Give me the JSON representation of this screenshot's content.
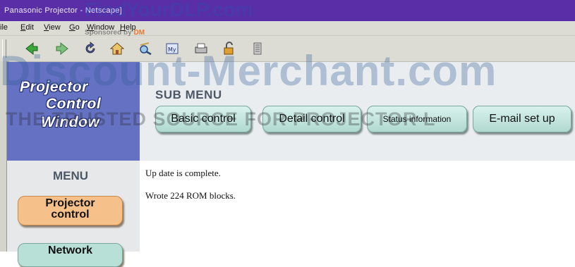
{
  "window": {
    "title": "Panasonic Projector - Netscape]"
  },
  "menu_bar": {
    "items": [
      {
        "label": "ile",
        "underline": ""
      },
      {
        "label": "Edit",
        "underline": "E"
      },
      {
        "label": "View",
        "underline": "V"
      },
      {
        "label": "Go",
        "underline": "G"
      },
      {
        "label": "Window",
        "underline": "W"
      },
      {
        "label": "Help",
        "underline": "H"
      }
    ]
  },
  "toolbar": {
    "icons": [
      "back-icon",
      "forward-icon",
      "reload-icon",
      "home-icon",
      "search-icon",
      "my-netscape-icon",
      "print-icon",
      "security-icon",
      "stop-icon"
    ]
  },
  "brand": {
    "lines": [
      "Projector",
      "Control",
      "Window"
    ]
  },
  "sub_menu": {
    "heading": "SUB MENU",
    "buttons": [
      "Basic control",
      "Detail control",
      "Status information",
      "E-mail set up"
    ]
  },
  "left_menu": {
    "heading": "MENU",
    "items": [
      {
        "line1": "Projector",
        "line2": "control"
      },
      {
        "line1": "Network",
        "line2": ""
      }
    ]
  },
  "content": {
    "lines": [
      "Up date is complete.",
      "Wrote 224 ROM blocks."
    ]
  },
  "watermark": {
    "site_top": "FindYourDLP.com",
    "sponsored": "Sponsored by",
    "sponsor_logo": "DM",
    "banner": "Discount-Merchant.com",
    "tagline": "THE TRUSTED SOURCE FOR PROJECTOR L"
  },
  "colors": {
    "title_bar": "#5a2ea6",
    "brand_panel": "#6572c4",
    "submenu_button": "#c6e8df",
    "menu_button_orange": "#f6c08a",
    "menu_button_teal": "#b8e0d6"
  }
}
